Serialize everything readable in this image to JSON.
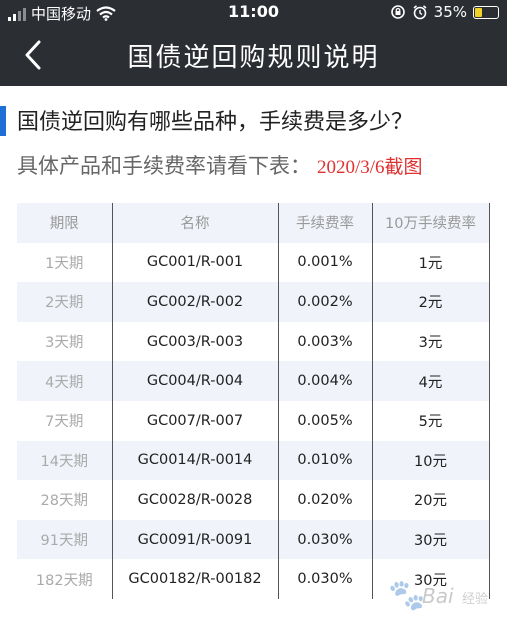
{
  "status_bar": {
    "carrier": "中国移动",
    "time": "11:00",
    "battery": "35%",
    "battery_level": 0.35
  },
  "nav": {
    "title": "国债逆回购规则说明"
  },
  "section": {
    "title": "国债逆回购有哪些品种，手续费是多少？"
  },
  "subtitle": "具体产品和手续费率请看下表：",
  "annotation": "2020/3/6截图",
  "table": {
    "headers": [
      "期限",
      "名称",
      "手续费率",
      "10万手续费率"
    ],
    "rows": [
      [
        "1天期",
        "GC001/R-001",
        "0.001%",
        "1元"
      ],
      [
        "2天期",
        "GC002/R-002",
        "0.002%",
        "2元"
      ],
      [
        "3天期",
        "GC003/R-003",
        "0.003%",
        "3元"
      ],
      [
        "4天期",
        "GC004/R-004",
        "0.004%",
        "4元"
      ],
      [
        "7天期",
        "GC007/R-007",
        "0.005%",
        "5元"
      ],
      [
        "14天期",
        "GC0014/R-0014",
        "0.010%",
        "10元"
      ],
      [
        "28天期",
        "GC0028/R-0028",
        "0.020%",
        "20元"
      ],
      [
        "91天期",
        "GC0091/R-0091",
        "0.030%",
        "30元"
      ],
      [
        "182天期",
        "GC00182/R-00182",
        "0.030%",
        "30元"
      ]
    ]
  },
  "watermark": {
    "brand": "Bai",
    "suffix": "经验"
  },
  "icons": {
    "back": "chevron-left-icon",
    "wifi": "wifi-icon",
    "signal": "cellular-signal-icon",
    "lock_rotation": "rotation-lock-icon",
    "alarm": "alarm-icon",
    "battery": "battery-icon"
  },
  "colors": {
    "nav_background": "#2b2e33",
    "accent": "#1e6fd6",
    "annotation": "#e03030",
    "stripe": "#f0f4fa"
  }
}
